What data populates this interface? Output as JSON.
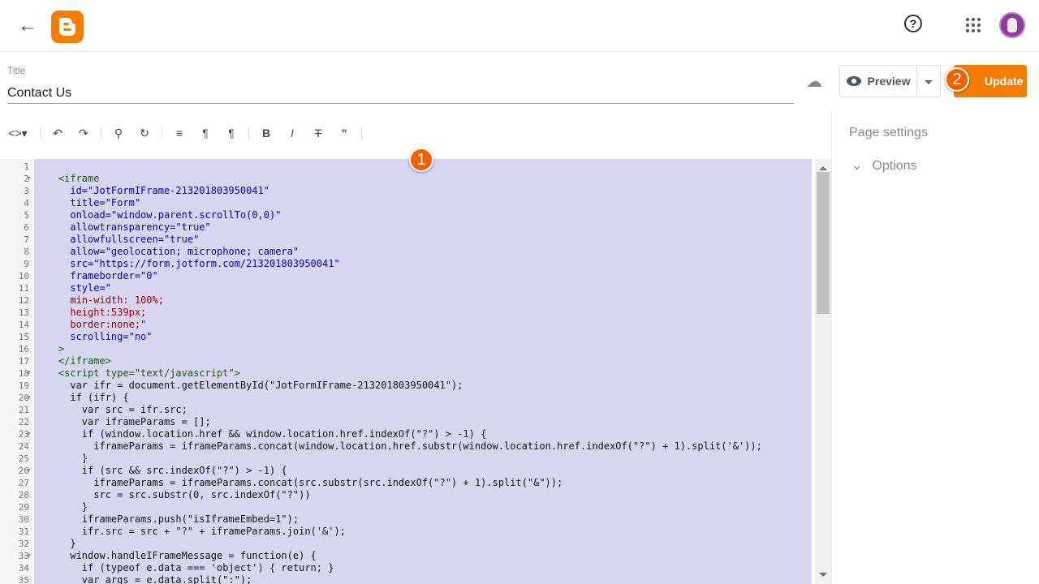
{
  "header": {
    "back_icon": "arrow-left",
    "logo": "Blogger",
    "help_icon": "help-circle",
    "apps_icon": "grid"
  },
  "title": {
    "label": "Title",
    "value": "Contact Us"
  },
  "actions": {
    "preview_label": "Preview",
    "update_label": "Update"
  },
  "annotations": {
    "badge1": "1",
    "badge2": "2"
  },
  "toolbar": [
    "code-toggle",
    "undo",
    "redo",
    "search",
    "replace",
    "align",
    "ltr",
    "rtl",
    "bold",
    "italic",
    "strikethrough",
    "quote"
  ],
  "sidebar": {
    "page_settings": "Page settings",
    "options": "Options"
  },
  "colors": {
    "accent": "#f57d00",
    "selection": "#d8d5f0"
  },
  "editor": {
    "fold_lines": [
      2,
      18,
      20,
      23,
      26,
      33
    ],
    "lines": [
      "",
      "    <iframe",
      "      id=\"JotFormIFrame-213201803950041\"",
      "      title=\"Form\"",
      "      onload=\"window.parent.scrollTo(0,0)\"",
      "      allowtransparency=\"true\"",
      "      allowfullscreen=\"true\"",
      "      allow=\"geolocation; microphone; camera\"",
      "      src=\"https://form.jotform.com/213201803950041\"",
      "      frameborder=\"0\"",
      "      style=\"",
      "      min-width: 100%;",
      "      height:539px;",
      "      border:none;\"",
      "      scrolling=\"no\"",
      "    >",
      "    </iframe>",
      "    <script type=\"text/javascript\">",
      "      var ifr = document.getElementById(\"JotFormIFrame-213201803950041\");",
      "      if (ifr) {",
      "        var src = ifr.src;",
      "        var iframeParams = [];",
      "        if (window.location.href && window.location.href.indexOf(\"?\") > -1) {",
      "          iframeParams = iframeParams.concat(window.location.href.substr(window.location.href.indexOf(\"?\") + 1).split('&'));",
      "        }",
      "        if (src && src.indexOf(\"?\") > -1) {",
      "          iframeParams = iframeParams.concat(src.substr(src.indexOf(\"?\") + 1).split(\"&\"));",
      "          src = src.substr(0, src.indexOf(\"?\"))",
      "        }",
      "        iframeParams.push(\"isIframeEmbed=1\");",
      "        ifr.src = src + \"?\" + iframeParams.join('&');",
      "      }",
      "      window.handleIFrameMessage = function(e) {",
      "        if (typeof e.data === 'object') { return; }",
      "        var args = e.data.split(\":\");"
    ]
  }
}
